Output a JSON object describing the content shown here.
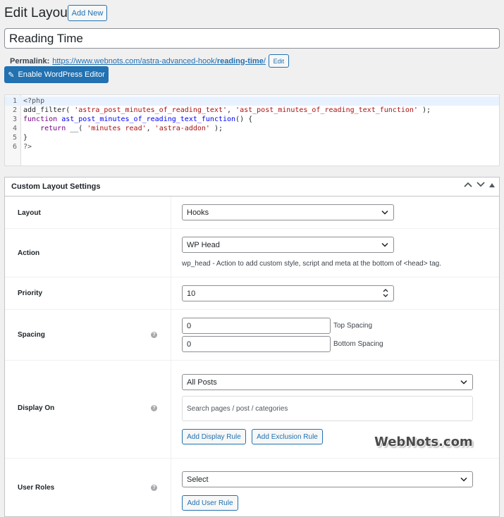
{
  "header": {
    "title": "Edit Layout",
    "add_new_label": "Add New"
  },
  "post_title": {
    "value": "Reading Time"
  },
  "permalink": {
    "label": "Permalink:",
    "url_base": "https://www.webnots.com/astra-advanced-hook/",
    "slug": "reading-time",
    "url_trail": "/",
    "edit_label": "Edit"
  },
  "editor_button": {
    "label": "Enable WordPress Editor",
    "icon": "pencil-icon"
  },
  "code": {
    "line_numbers": [
      "1",
      "2",
      "3",
      "4",
      "5",
      "6"
    ]
  },
  "panel": {
    "title": "Custom Layout Settings",
    "controls": [
      "chevron-up-icon",
      "chevron-down-icon",
      "triangle-up-icon"
    ]
  },
  "settings": {
    "layout": {
      "label": "Layout",
      "value": "Hooks"
    },
    "action": {
      "label": "Action",
      "value": "WP Head",
      "description": "wp_head - Action to add custom style, script and meta at the bottom of <head> tag."
    },
    "priority": {
      "label": "Priority",
      "value": "10"
    },
    "spacing": {
      "label": "Spacing",
      "top_value": "0",
      "top_label": "Top Spacing",
      "bottom_value": "0",
      "bottom_label": "Bottom Spacing"
    },
    "display_on": {
      "label": "Display On",
      "value": "All Posts",
      "search_placeholder": "Search pages / post / categories",
      "add_display_rule": "Add Display Rule",
      "add_exclusion_rule": "Add Exclusion Rule"
    },
    "user_roles": {
      "label": "User Roles",
      "value": "Select",
      "add_user_rule": "Add User Rule"
    }
  },
  "watermark": "WebNots.com"
}
